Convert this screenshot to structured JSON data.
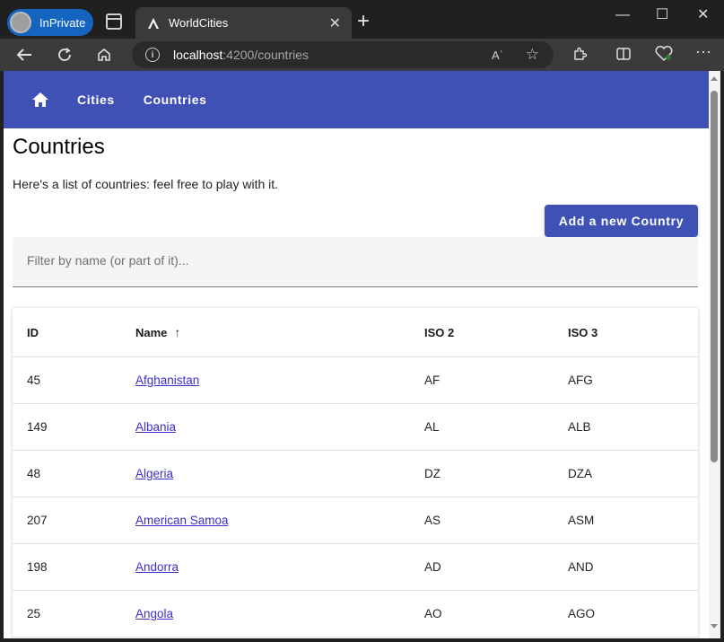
{
  "browser": {
    "inprivate_label": "InPrivate",
    "tab_title": "WorldCities",
    "tab_close": "✕",
    "new_tab": "+",
    "url_host": "localhost",
    "url_path": ":4200/countries",
    "readaloud": "Aʾ",
    "window_controls": {
      "minimize": "—",
      "maximize": "☐",
      "close": "✕"
    }
  },
  "app": {
    "nav": {
      "cities": "Cities",
      "countries": "Countries"
    },
    "page_title": "Countries",
    "intro": "Here's a list of countries: feel free to play with it.",
    "add_button": "Add a new Country",
    "filter_placeholder": "Filter by name (or part of it)..."
  },
  "table": {
    "columns": [
      "ID",
      "Name",
      "ISO 2",
      "ISO 3"
    ],
    "sort_indicator": "↑",
    "rows": [
      {
        "id": "45",
        "name": "Afghanistan",
        "iso2": "AF",
        "iso3": "AFG"
      },
      {
        "id": "149",
        "name": "Albania",
        "iso2": "AL",
        "iso3": "ALB"
      },
      {
        "id": "48",
        "name": "Algeria",
        "iso2": "DZ",
        "iso3": "DZA"
      },
      {
        "id": "207",
        "name": "American Samoa",
        "iso2": "AS",
        "iso3": "ASM"
      },
      {
        "id": "198",
        "name": "Andorra",
        "iso2": "AD",
        "iso3": "AND"
      },
      {
        "id": "25",
        "name": "Angola",
        "iso2": "AO",
        "iso3": "AGO"
      }
    ]
  },
  "colors": {
    "primary": "#3f51b5",
    "link": "#3b30c7",
    "inprivate": "#1565c0"
  }
}
